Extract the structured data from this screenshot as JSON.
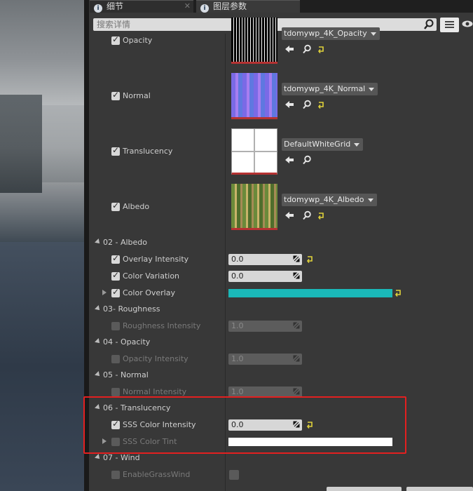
{
  "tabs": [
    {
      "label": "细节",
      "icon": "details-icon"
    },
    {
      "label": "图层参数",
      "icon": "layer-params-icon"
    }
  ],
  "search": {
    "placeholder": "搜索详情"
  },
  "textures": [
    {
      "label": "Opacity",
      "asset": "tdomywp_4K_Opacity",
      "checked": true
    },
    {
      "label": "Normal",
      "asset": "tdomywp_4K_Normal",
      "checked": true
    },
    {
      "label": "Translucency",
      "asset": "DefaultWhiteGrid",
      "checked": true
    },
    {
      "label": "Albedo",
      "asset": "tdomywp_4K_Albedo",
      "checked": true
    }
  ],
  "groups": {
    "albedo": {
      "title": "02 - Albedo",
      "overlay_intensity": {
        "label": "Overlay Intensity",
        "value": "0.0"
      },
      "color_variation": {
        "label": "Color Variation",
        "value": "0.0"
      },
      "color_overlay": {
        "label": "Color Overlay",
        "color": "#1ab8b8"
      }
    },
    "roughness": {
      "title": "03- Roughness",
      "intensity": {
        "label": "Roughness Intensity",
        "value": "1.0"
      }
    },
    "opacity": {
      "title": "04 - Opacity",
      "intensity": {
        "label": "Opacity Intensity",
        "value": "1.0"
      }
    },
    "normal": {
      "title": "05 - Normal",
      "intensity": {
        "label": "Normal Intensity",
        "value": "1.0"
      }
    },
    "translucency": {
      "title": "06 - Translucency",
      "sss_intensity": {
        "label": "SSS Color Intensity",
        "value": "0.0"
      },
      "sss_tint": {
        "label": "SSS Color Tint",
        "color": "#ffffff"
      }
    },
    "wind": {
      "title": "07 - Wind",
      "enable": {
        "label": "EnableGrassWind"
      }
    }
  },
  "colors": {
    "highlight": "#e32020",
    "reset_arrow": "#e0d23a"
  }
}
